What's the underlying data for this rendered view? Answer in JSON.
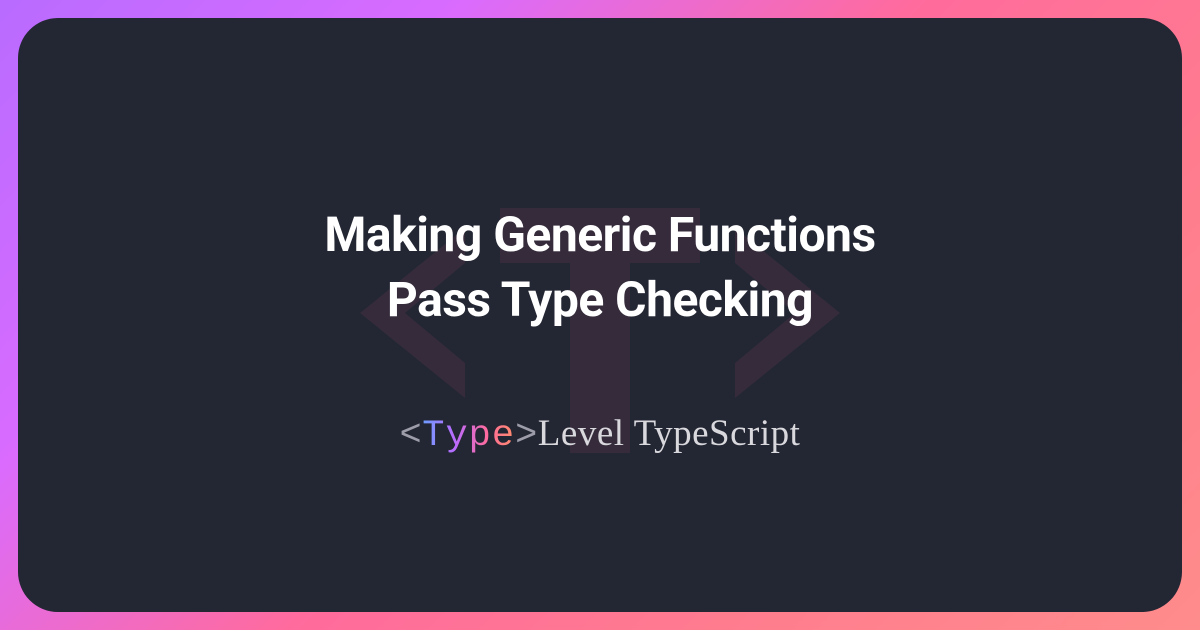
{
  "title": {
    "line1": "Making Generic Functions",
    "line2": "Pass Type Checking"
  },
  "brand": {
    "angle_open": "<",
    "type_word": "Type",
    "angle_close": ">",
    "rest": "Level TypeScript"
  },
  "colors": {
    "card_bg": "#232633",
    "gradient_start": "#b96bff",
    "gradient_end": "#ff8c8c"
  }
}
